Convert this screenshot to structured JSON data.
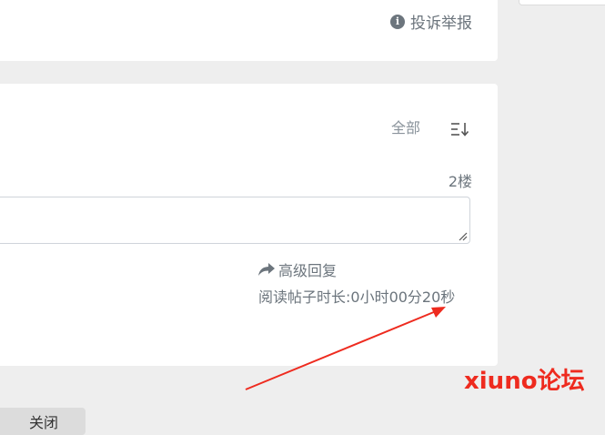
{
  "top_card": {
    "report_label": "投诉举报",
    "report_icon": "info-icon"
  },
  "reply_card": {
    "filter_label": "全部",
    "sort_icon": "sort-descending-icon",
    "floor_label": "2楼",
    "reply_placeholder": "",
    "advanced_reply_label": "高级回复",
    "advanced_reply_icon": "share-arrow-icon",
    "read_time_label": "阅读帖子时长:0小时00分20秒"
  },
  "watermark": {
    "text": "xiuno论坛",
    "color": "#ee2b1f"
  },
  "footer": {
    "close_label": "关闭"
  },
  "colors": {
    "background": "#eeeeee",
    "card": "#ffffff",
    "muted_text": "#6c757d",
    "annotation_arrow": "#ee2b1f"
  }
}
